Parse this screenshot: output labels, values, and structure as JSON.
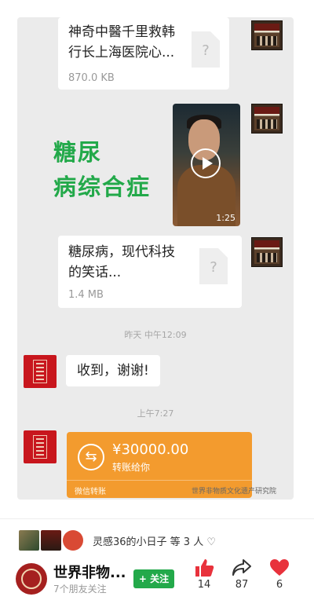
{
  "chat": {
    "file1": {
      "name": "神奇中醫千里救韩\n行长上海医院心...",
      "size": "870.0 KB",
      "icon": "?"
    },
    "video": {
      "caption": "糖尿\n病综合症",
      "duration": "1:25"
    },
    "file2": {
      "name": "糖尿病，现代科技\n的笑话...",
      "size": "1.4 MB",
      "icon": "?"
    },
    "time1": "昨天 中午12:09",
    "msg1": "收到，谢谢!",
    "time2": "上午7:27",
    "transfer": {
      "amount": "¥30000.00",
      "desc": "转账给你",
      "footer": "微信转账"
    },
    "watermark": "世界非物质文化遗产研究院"
  },
  "post": {
    "likers_text": "灵感36的小日子 等 3 人",
    "account_name": "世界非物...",
    "account_sub": "7个朋友关注",
    "follow_label": "+ 关注",
    "like_count": "14",
    "share_count": "87",
    "heart_count": "6"
  },
  "colors": {
    "green": "#23a94a",
    "orange": "#f39b2e",
    "red": "#e8323c"
  }
}
